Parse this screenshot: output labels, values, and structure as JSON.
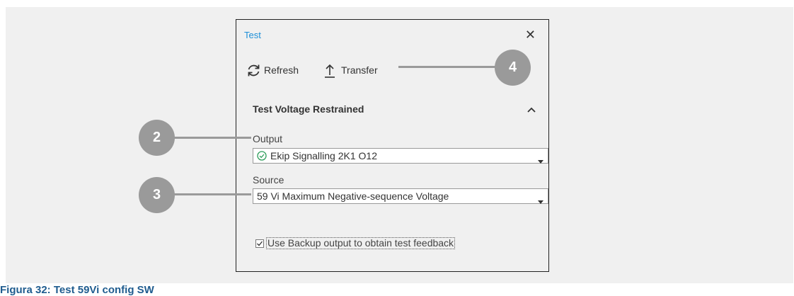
{
  "dialog": {
    "title": "Test",
    "toolbar": {
      "refresh_label": "Refresh",
      "transfer_label": "Transfer"
    },
    "section": {
      "title": "Test Voltage Restrained",
      "output": {
        "label": "Output",
        "value": "Ekip Signalling 2K1 O12",
        "status_icon": "check-circle-icon"
      },
      "source": {
        "label": "Source",
        "value": "59 Vi Maximum Negative-sequence Voltage"
      },
      "backup": {
        "label": "Use Backup output to obtain test feedback",
        "checked": true
      }
    }
  },
  "callouts": [
    "2",
    "3",
    "4"
  ],
  "caption": "Figura 32: Test 59Vi config SW",
  "colors": {
    "accent": "#1e8fd8",
    "callout": "#9a9a9a",
    "caption": "#1f5c8f",
    "ok_green": "#2e9e5b"
  }
}
